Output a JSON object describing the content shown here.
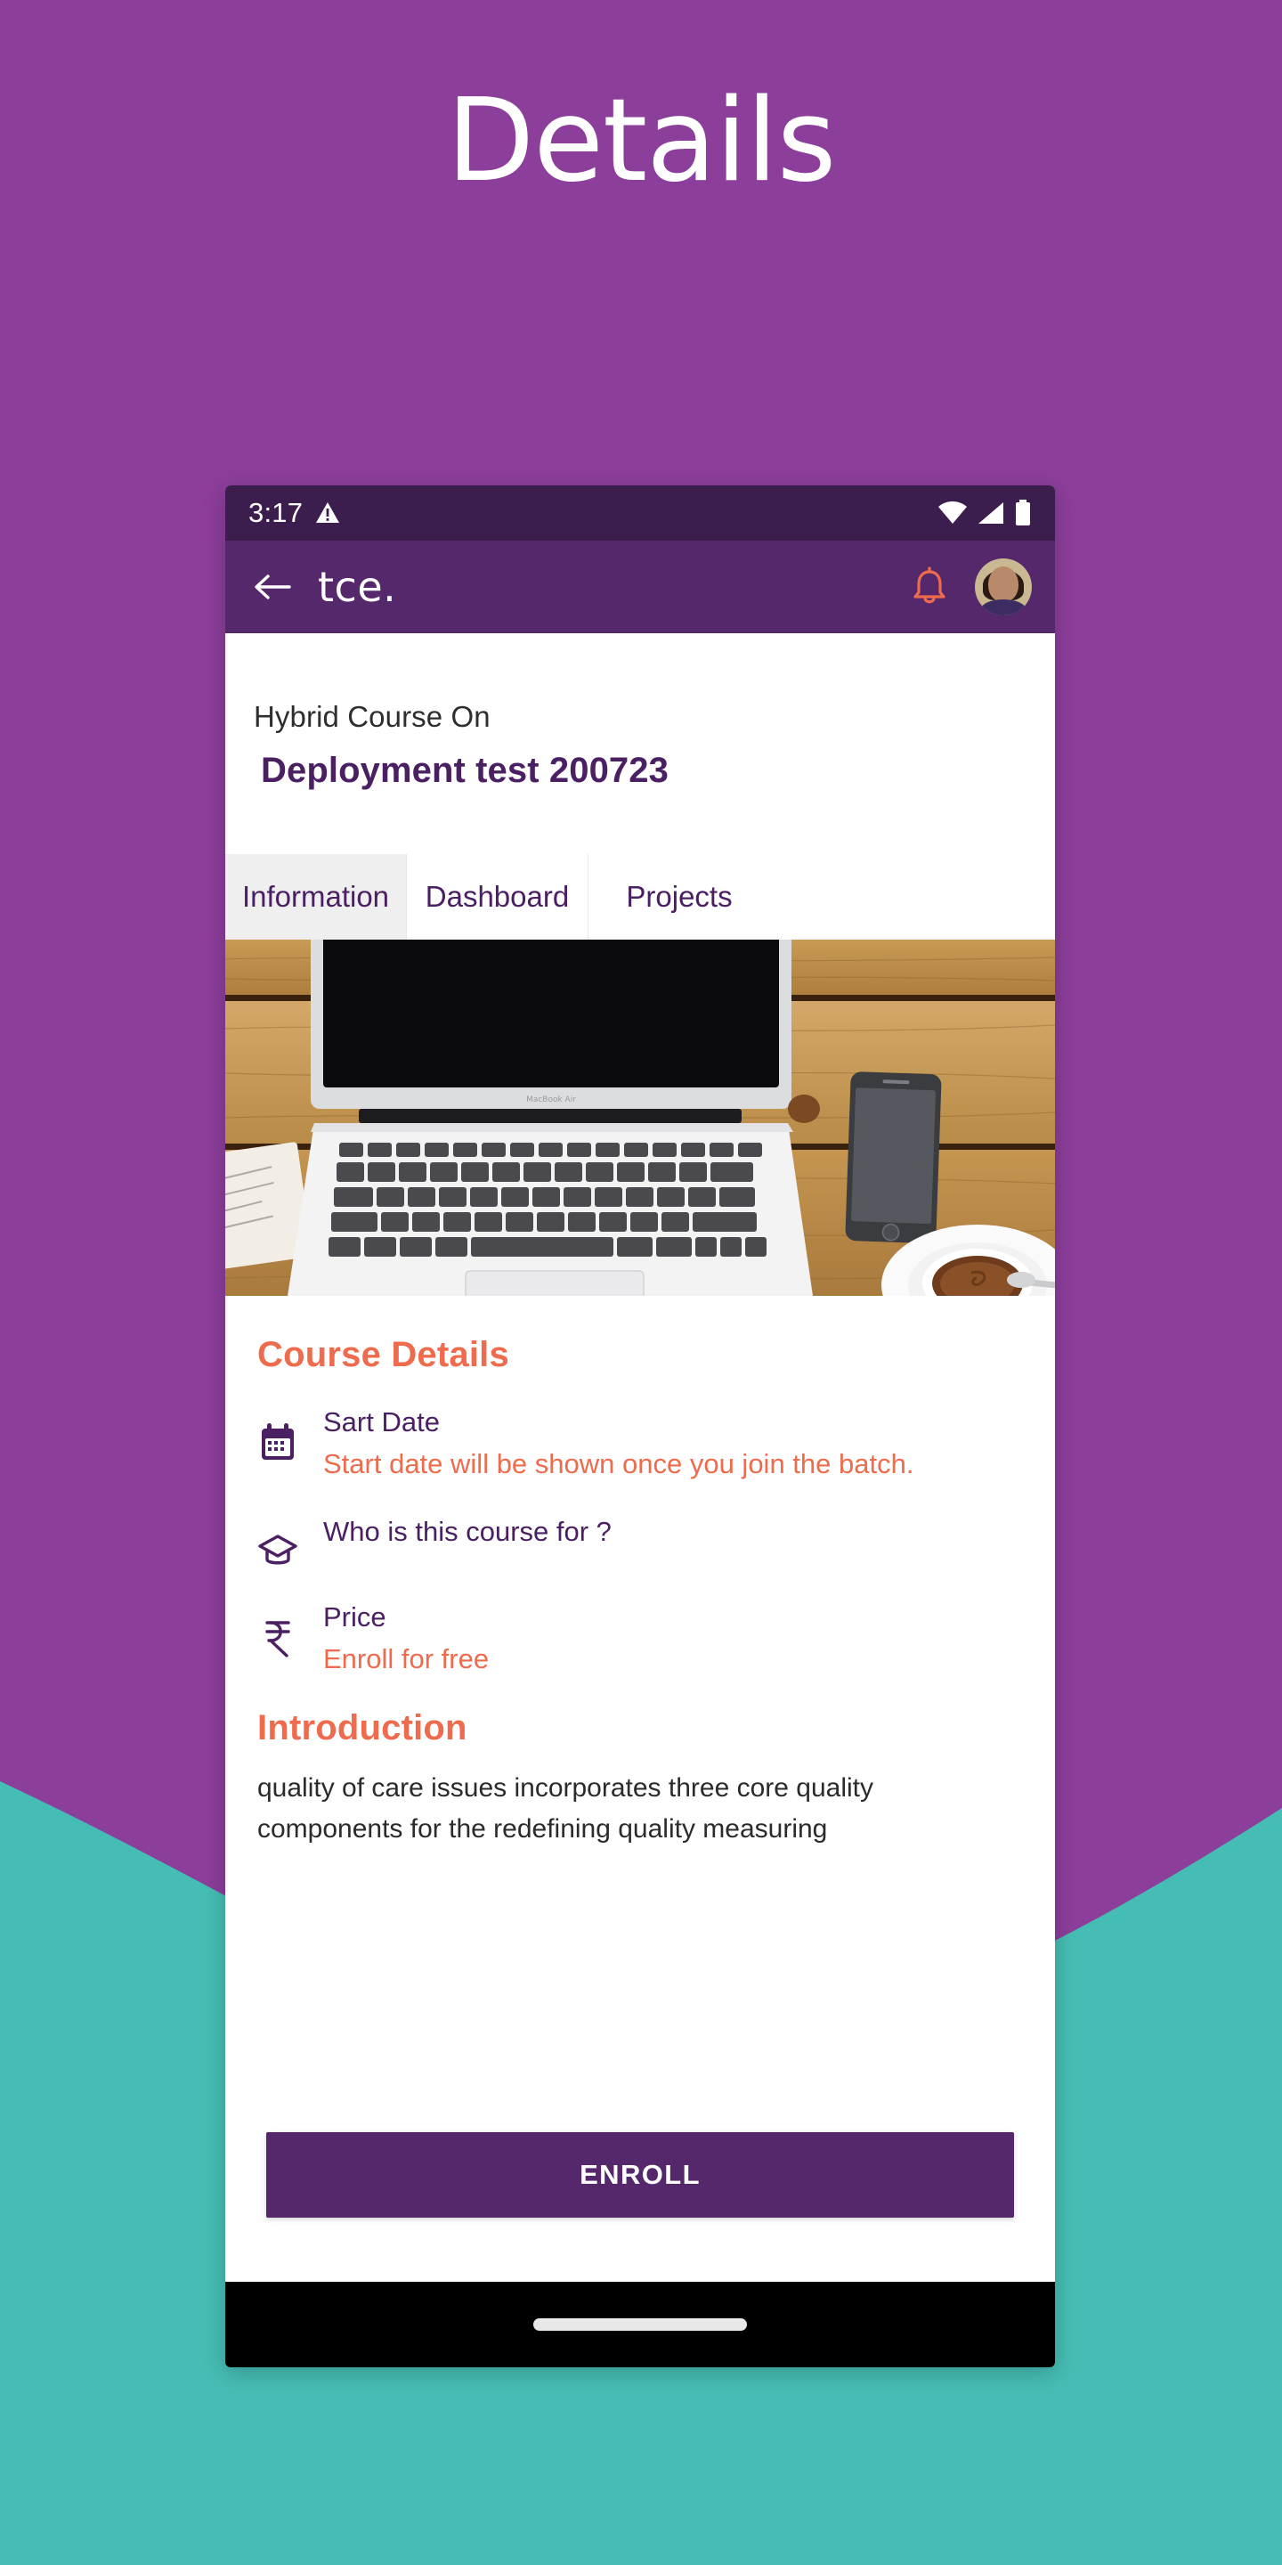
{
  "promo": {
    "heading": "Details",
    "background_color": "#8C3E9B",
    "wave_color": "#46BDB4"
  },
  "phone": {
    "status_bar": {
      "time": "3:17",
      "icons": [
        "warning-triangle-icon",
        "wifi-icon",
        "cellular-signal-icon",
        "battery-icon"
      ],
      "background_color": "#3B1E4E"
    },
    "app_bar": {
      "back_label": "back-arrow-icon",
      "brand": "tce.",
      "notification_icon": "bell-icon",
      "notification_color": "#EE6C4D",
      "avatar_label": "user-avatar",
      "background_color": "#54286B"
    },
    "course": {
      "kicker": "Hybrid Course On",
      "title": "Deployment test 200723",
      "title_color": "#4B2063"
    },
    "tabs": [
      {
        "label": "Information",
        "active": true
      },
      {
        "label": "Dashboard",
        "active": false
      },
      {
        "label": "Projects",
        "active": false
      }
    ],
    "hero": {
      "alt": "laptop-on-wooden-desk-photo"
    },
    "details_section": {
      "heading": "Course Details",
      "heading_color": "#EE6C4D",
      "rows": [
        {
          "icon": "calendar-icon",
          "label": "Sart Date",
          "value": "Start date will be shown once you join the batch."
        },
        {
          "icon": "graduation-cap-icon",
          "label": "Who is this course for ?",
          "value": ""
        },
        {
          "icon": "rupee-icon",
          "label": "Price",
          "value": "Enroll for free"
        }
      ]
    },
    "introduction": {
      "heading": "Introduction",
      "body": "quality of care issues incorporates three core quality components for the redefining quality measuring"
    },
    "enroll_button": {
      "label": "ENROLL",
      "background_color": "#54286B"
    },
    "nav_bar": {
      "gesture_pill": "home-gesture-pill"
    }
  }
}
